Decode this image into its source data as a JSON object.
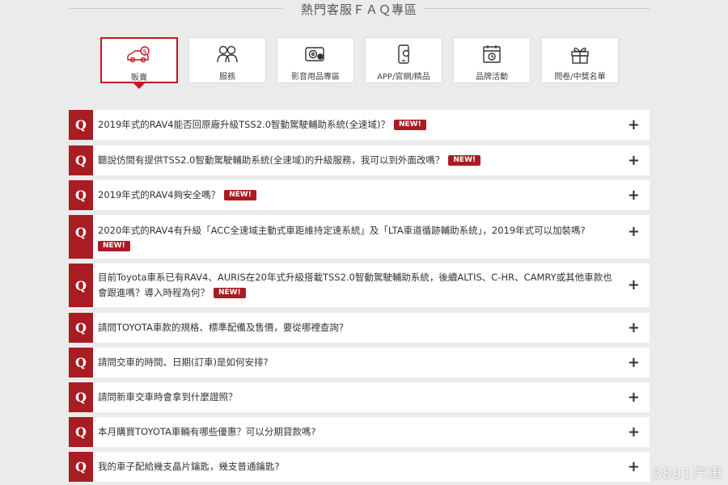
{
  "page_title": "熱門客服ＦＡＱ專區",
  "categories": [
    {
      "label": "販賣",
      "icon": "car-dollar-icon",
      "active": true
    },
    {
      "label": "服務",
      "icon": "people-icon",
      "active": false
    },
    {
      "label": "影音用品專區",
      "icon": "media-device-icon",
      "active": false
    },
    {
      "label": "APP/官網/精品",
      "icon": "mobile-app-icon",
      "active": false
    },
    {
      "label": "品牌活動",
      "icon": "calendar-icon",
      "active": false
    },
    {
      "label": "問卷/中獎名單",
      "icon": "gift-icon",
      "active": false
    }
  ],
  "faq_badge": "Q",
  "new_badge": "NEW!",
  "faq": [
    {
      "text": "2019年式的RAV4能否回原廠升級TSS2.0智動駕駛輔助系統(全速域)？",
      "is_new": true
    },
    {
      "text": "聽說仿間有提供TSS2.0智動駕駛輔助系統(全速域)的升級服務，我可以到外面改嗎？",
      "is_new": true
    },
    {
      "text": "2019年式的RAV4夠安全嗎？",
      "is_new": true
    },
    {
      "text": "2020年式的RAV4有升級「ACC全速域主動式車距維持定速系統」及「LTA車道循跡輔助系統」，2019年式可以加裝嗎?",
      "is_new": true
    },
    {
      "text": "目前Toyota車系已有RAV4、AURIS在20年式升級搭載TSS2.0智動駕駛輔助系統，後續ALTIS、C-HR、CAMRY或其他車款也會跟進嗎？導入時程為何？",
      "is_new": true
    },
    {
      "text": "請問TOYOTA車款的規格、標準配備及售價，要從哪裡查詢?",
      "is_new": false
    },
    {
      "text": "請問交車的時間、日期(訂車)是如何安排?",
      "is_new": false
    },
    {
      "text": "請問新車交車時會拿到什麼證照？",
      "is_new": false
    },
    {
      "text": "本月購買TOYOTA車輛有哪些優惠？可以分期貸款嗎?",
      "is_new": false
    },
    {
      "text": "我的車子配給幾支晶片鑰匙，幾支普通鑰匙?",
      "is_new": false
    }
  ],
  "expand_symbol": "+",
  "watermark": "8891汽車",
  "colors": {
    "accent": "#a91c22",
    "active_border": "#c8161d",
    "background": "#ebebeb"
  }
}
